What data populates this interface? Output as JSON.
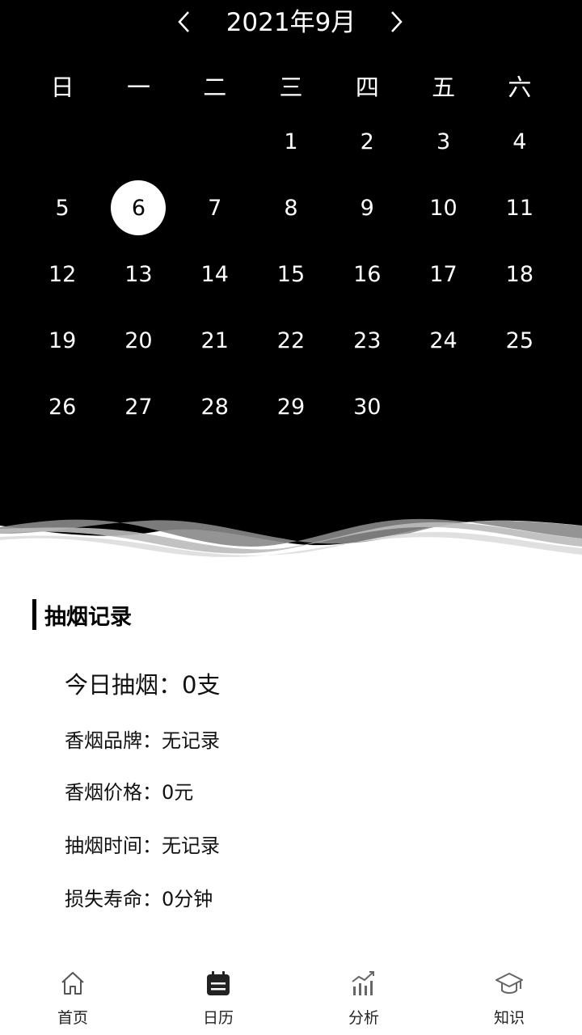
{
  "calendar": {
    "month_title": "2021年9月",
    "prev_icon": "chevron-left-icon",
    "next_icon": "chevron-right-icon",
    "weekdays": [
      "日",
      "一",
      "二",
      "三",
      "四",
      "五",
      "六"
    ],
    "weeks": [
      [
        "",
        "",
        "",
        "1",
        "2",
        "3",
        "4"
      ],
      [
        "5",
        "6",
        "7",
        "8",
        "9",
        "10",
        "11"
      ],
      [
        "12",
        "13",
        "14",
        "15",
        "16",
        "17",
        "18"
      ],
      [
        "19",
        "20",
        "21",
        "22",
        "23",
        "24",
        "25"
      ],
      [
        "26",
        "27",
        "28",
        "29",
        "30",
        "",
        ""
      ]
    ],
    "selected_day": "6"
  },
  "record": {
    "title": "抽烟记录",
    "today_smoke": "今日抽烟：0支",
    "brand": "香烟品牌：无记录",
    "price": "香烟价格：0元",
    "time": "抽烟时间：无记录",
    "life_lost": "损失寿命：0分钟"
  },
  "tabs": [
    {
      "label": "首页",
      "icon": "home-icon"
    },
    {
      "label": "日历",
      "icon": "calendar-icon"
    },
    {
      "label": "分析",
      "icon": "chart-icon"
    },
    {
      "label": "知识",
      "icon": "graduation-cap-icon"
    }
  ]
}
